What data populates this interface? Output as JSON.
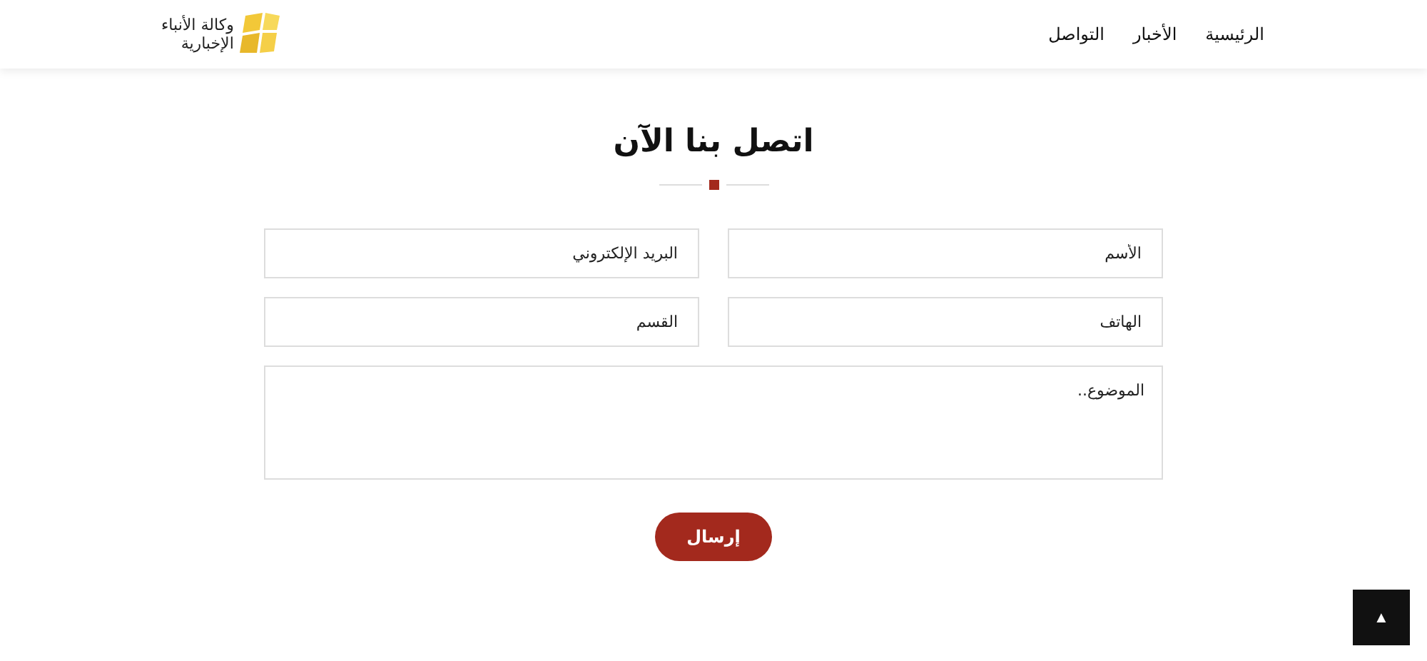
{
  "header": {
    "logo": {
      "lines": [
        "وكالة الأنباء",
        "الإخبارية"
      ]
    },
    "nav": [
      {
        "label": "الرئيسية"
      },
      {
        "label": "الأخبار"
      },
      {
        "label": "التواصل"
      }
    ]
  },
  "contact": {
    "title": "اتصل بنا الآن",
    "fields": [
      {
        "placeholder": "الأسم",
        "kind": "text"
      },
      {
        "placeholder": "البريد الإلكتروني",
        "kind": "text"
      },
      {
        "placeholder": "الهاتف",
        "kind": "text"
      },
      {
        "placeholder": "القسم",
        "kind": "text"
      },
      {
        "placeholder": "الموضوع..",
        "kind": "textarea"
      }
    ],
    "submit": "إرسال"
  },
  "scroll_top": {
    "label": "▲"
  }
}
